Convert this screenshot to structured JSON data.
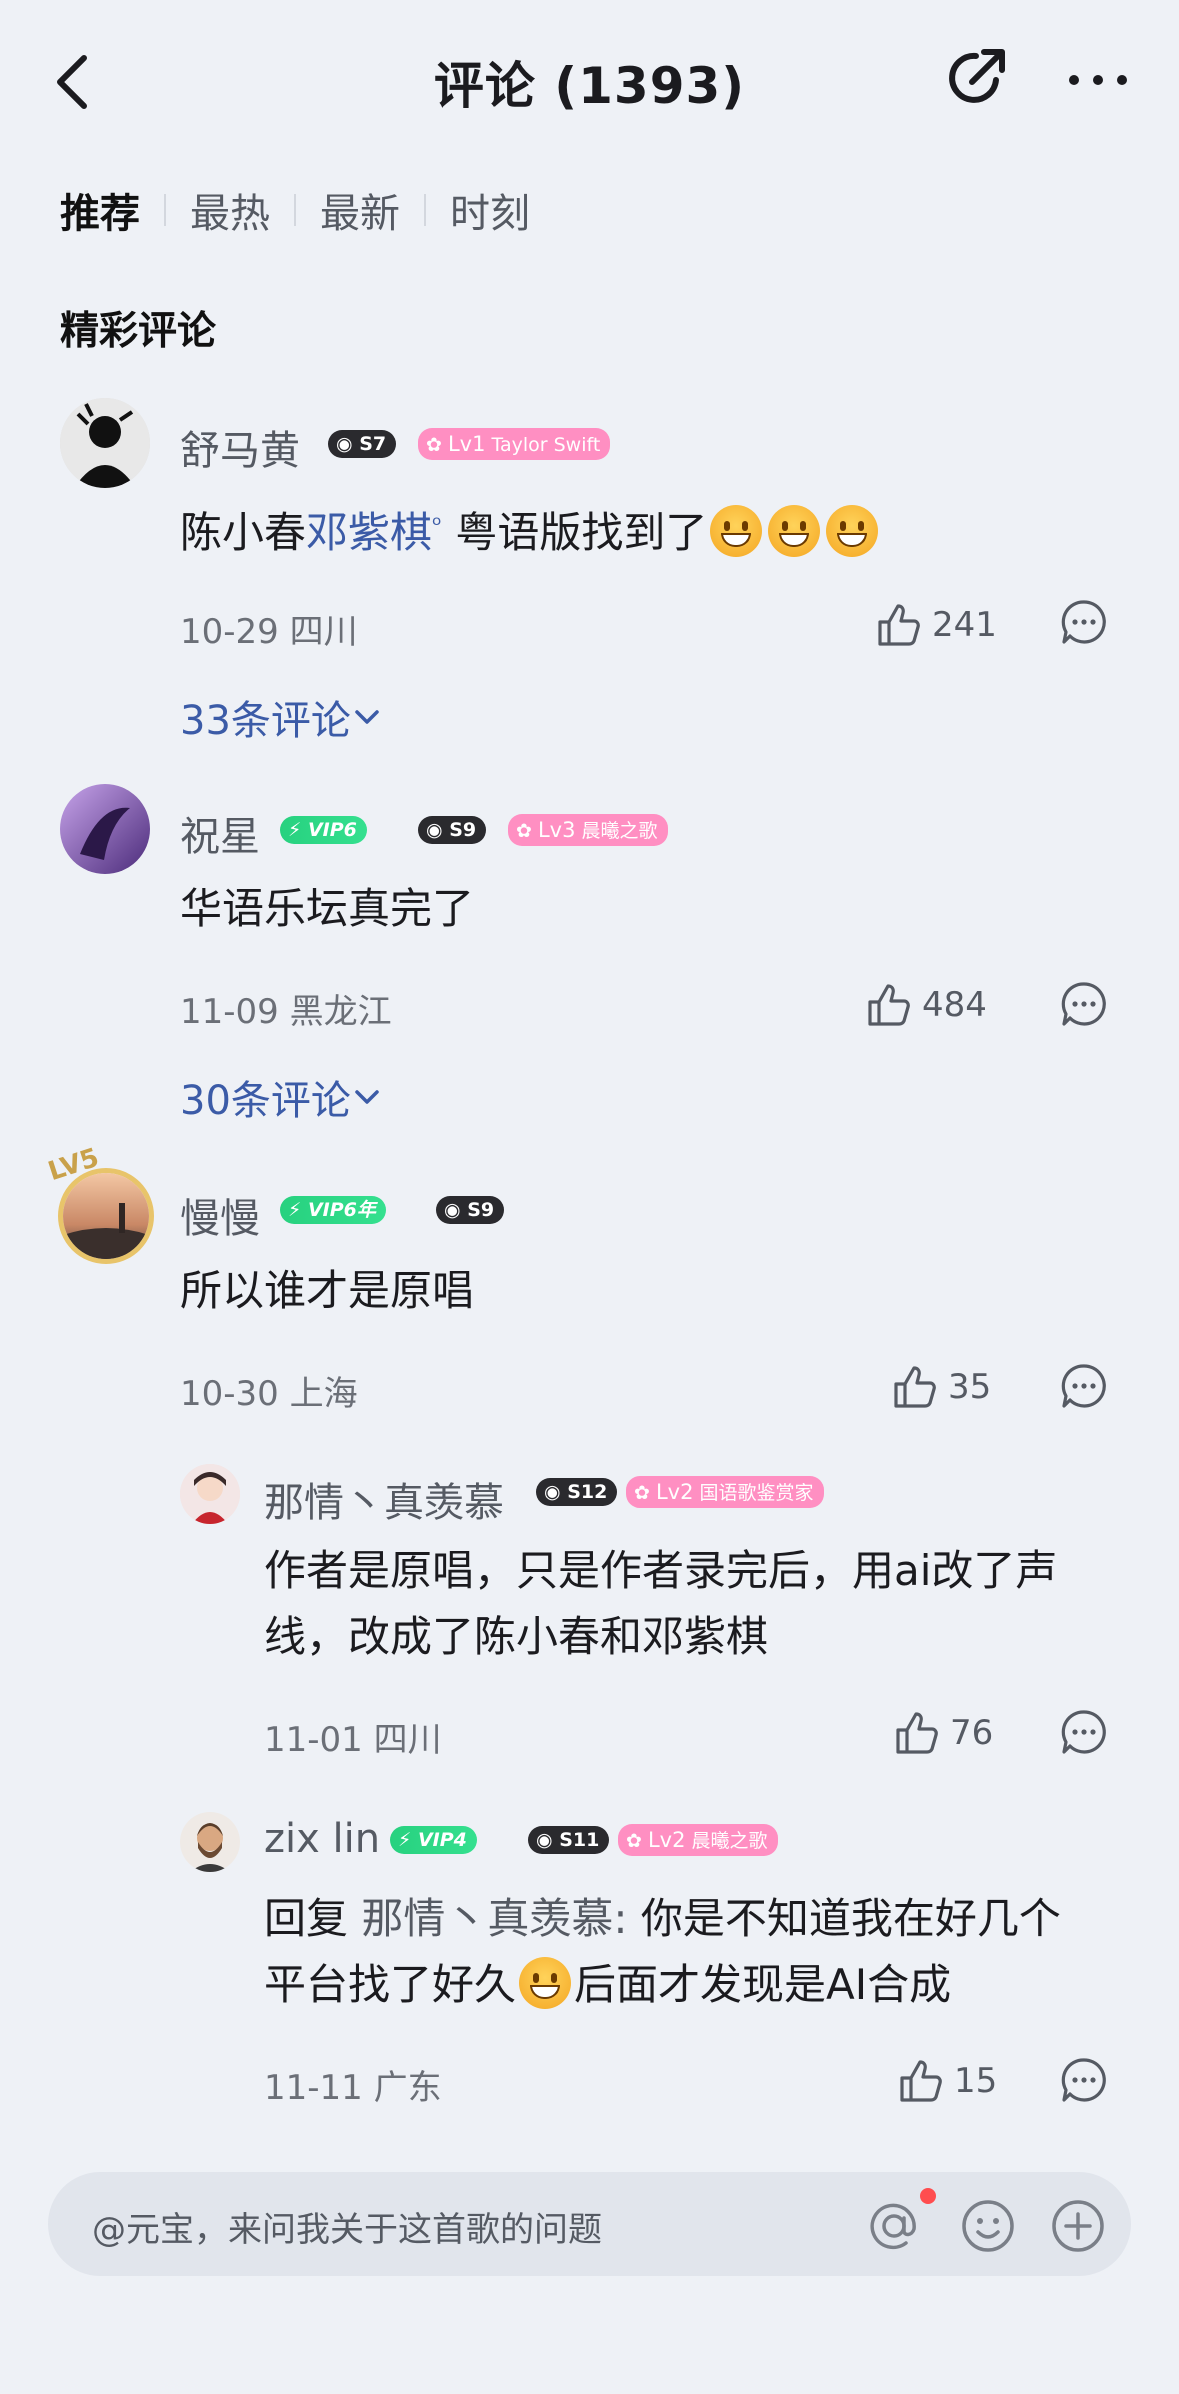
{
  "header": {
    "title": "评论 (1393)"
  },
  "tabs": [
    "推荐",
    "最热",
    "最新",
    "时刻"
  ],
  "section_title": "精彩评论",
  "comments": [
    {
      "name": "舒马黄",
      "badges": {
        "s": "S7",
        "lv": "Lv1",
        "lv_tag": "Taylor Swift"
      },
      "text_a": "陈小春",
      "mention": "邓紫棋",
      "text_b": " 粤语版找到了",
      "meta": "10-29 四川",
      "likes": "241",
      "replies": "33条评论"
    },
    {
      "name": "祝星",
      "badges": {
        "vip": "VIP6",
        "s": "S9",
        "lv": "Lv3",
        "lv_tag": "晨曦之歌"
      },
      "text": "华语乐坛真完了",
      "meta": "11-09 黑龙江",
      "likes": "484",
      "replies": "30条评论"
    },
    {
      "name": "慢慢",
      "badges": {
        "vip": "VIP6年",
        "s": "S9",
        "frame": "LV5"
      },
      "text": "所以谁才是原唱",
      "meta": "10-30 上海",
      "likes": "35"
    }
  ],
  "sub_replies": [
    {
      "name": "那情丶真羡慕",
      "badges": {
        "s": "S12",
        "lv": "Lv2",
        "lv_tag": "国语歌鉴赏家"
      },
      "text_line1": "作者是原唱，只是作者录完后，用ai改了声",
      "text_line2": "线，改成了陈小春和邓紫棋",
      "meta": "11-01 四川",
      "likes": "76"
    },
    {
      "name": "zix lin",
      "badges": {
        "vip": "VIP4",
        "s": "S11",
        "lv": "Lv2",
        "lv_tag": "晨曦之歌"
      },
      "reply_prefix": "回复 ",
      "reply_to": "那情丶真羡慕:",
      "text_line1": " 你是不知道我在好几个",
      "text_line2a": "平台找了好久",
      "text_line2b": "后面才发现是AI合成",
      "meta": "11-11 广东",
      "likes": "15"
    }
  ],
  "input": {
    "placeholder": "@元宝，来问我关于这首歌的问题"
  },
  "icons": [
    "back-icon",
    "share-icon",
    "more-icon",
    "like-icon",
    "reply-icon",
    "chevron-down-icon",
    "at-icon",
    "emoji-icon",
    "plus-icon"
  ]
}
